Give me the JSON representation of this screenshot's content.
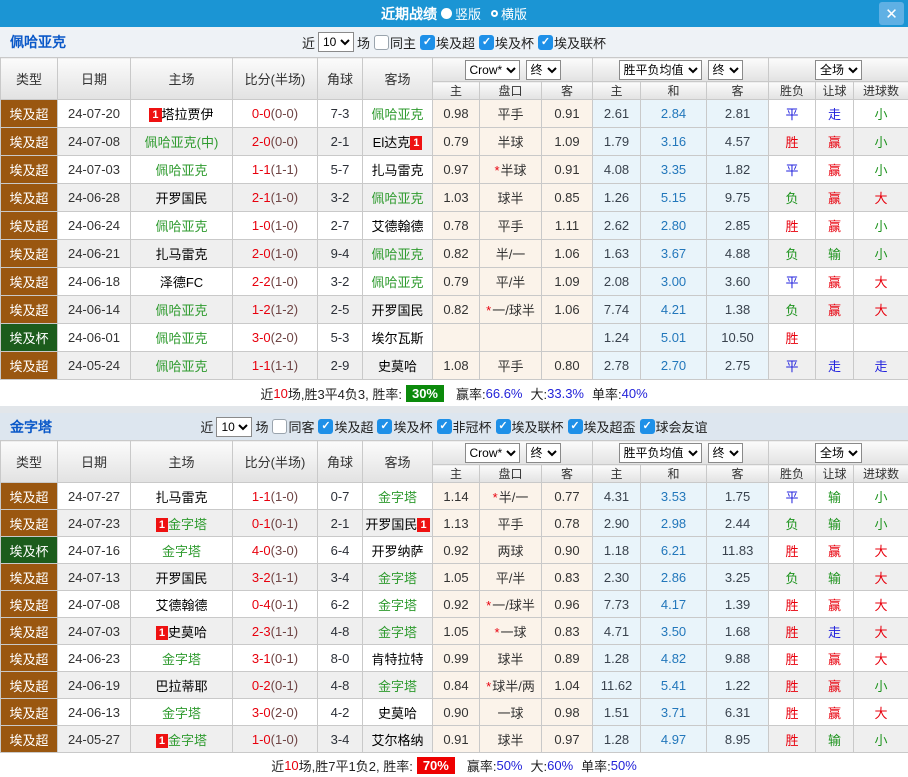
{
  "titlebar": {
    "title": "近期战绩",
    "vertical_label": "竖版",
    "horizontal_label": "横版",
    "close_glyph": "✕"
  },
  "colors": {
    "titlebar": "#1b95d4",
    "league_super": "#9a5710",
    "league_cup": "#1c5c1c",
    "team_highlight": "#2f9b2f",
    "win": "#e8000d",
    "draw": "#2222dd",
    "lose": "#1f941f",
    "rate_green": "#0b8a0b",
    "rate_red": "#ee0000"
  },
  "header": {
    "c1": "类型",
    "c2": "日期",
    "c3": "主场",
    "c4": "比分(半场)",
    "c5": "角球",
    "c6": "客场",
    "sel_crow": "Crow*",
    "sel_end1": "终",
    "sel_avg": "胜平负均值",
    "sel_end2": "终",
    "sel_scope": "全场",
    "s1": "主",
    "s2": "盘口",
    "s3": "客",
    "s4": "主",
    "s5": "和",
    "s6": "客",
    "s7": "胜负",
    "s8": "让球",
    "s9": "进球数"
  },
  "sections": [
    {
      "team": "佩哈亚克",
      "filter": {
        "near": "近",
        "games": "10",
        "chang": "场",
        "same": "同主",
        "same_checked": false,
        "leagues": [
          {
            "label": "埃及超",
            "checked": true
          },
          {
            "label": "埃及杯",
            "checked": true
          },
          {
            "label": "埃及联杯",
            "checked": true
          }
        ]
      },
      "rows": [
        {
          "type": "埃及超",
          "tc": "brown",
          "date": "24-07-20",
          "hb": "1",
          "hbp": "l",
          "home": "塔拉贾伊",
          "hT": false,
          "ft": "0-0",
          "half": "(0-0)",
          "corner": "7-3",
          "away": "佩哈亚克",
          "aT": true,
          "h1": "0.98",
          "star": false,
          "hcap": "平手",
          "h2": "0.91",
          "e1": "2.61",
          "e2": "2.84",
          "e3": "2.81",
          "r1": "平",
          "r1c": "blue",
          "r2": "走",
          "r2c": "blue",
          "r3": "小",
          "r3c": "green"
        },
        {
          "type": "埃及超",
          "tc": "brown",
          "date": "24-07-08",
          "home": "佩哈亚克(中)",
          "hT": true,
          "ft": "2-0",
          "half": "(0-0)",
          "corner": "2-1",
          "away": "El达克",
          "aT": false,
          "ab": "1",
          "abp": "r",
          "h1": "0.79",
          "star": false,
          "hcap": "半球",
          "h2": "1.09",
          "e1": "1.79",
          "e2": "3.16",
          "e3": "4.57",
          "r1": "胜",
          "r1c": "red",
          "r2": "赢",
          "r2c": "red",
          "r3": "小",
          "r3c": "green"
        },
        {
          "type": "埃及超",
          "tc": "brown",
          "date": "24-07-03",
          "home": "佩哈亚克",
          "hT": true,
          "ft": "1-1",
          "half": "(1-1)",
          "corner": "5-7",
          "away": "扎马雷克",
          "aT": false,
          "h1": "0.97",
          "star": true,
          "hcap": "半球",
          "h2": "0.91",
          "e1": "4.08",
          "e2": "3.35",
          "e3": "1.82",
          "r1": "平",
          "r1c": "blue",
          "r2": "赢",
          "r2c": "red",
          "r3": "小",
          "r3c": "green"
        },
        {
          "type": "埃及超",
          "tc": "brown",
          "date": "24-06-28",
          "home": "开罗国民",
          "hT": false,
          "ft": "2-1",
          "half": "(1-0)",
          "corner": "3-2",
          "away": "佩哈亚克",
          "aT": true,
          "h1": "1.03",
          "star": false,
          "hcap": "球半",
          "h2": "0.85",
          "e1": "1.26",
          "e2": "5.15",
          "e3": "9.75",
          "r1": "负",
          "r1c": "green",
          "r2": "赢",
          "r2c": "red",
          "r3": "大",
          "r3c": "red"
        },
        {
          "type": "埃及超",
          "tc": "brown",
          "date": "24-06-24",
          "home": "佩哈亚克",
          "hT": true,
          "ft": "1-0",
          "half": "(1-0)",
          "corner": "2-7",
          "away": "艾德翰德",
          "aT": false,
          "h1": "0.78",
          "star": false,
          "hcap": "平手",
          "h2": "1.11",
          "e1": "2.62",
          "e2": "2.80",
          "e3": "2.85",
          "r1": "胜",
          "r1c": "red",
          "r2": "赢",
          "r2c": "red",
          "r3": "小",
          "r3c": "green"
        },
        {
          "type": "埃及超",
          "tc": "brown",
          "date": "24-06-21",
          "home": "扎马雷克",
          "hT": false,
          "ft": "2-0",
          "half": "(1-0)",
          "corner": "9-4",
          "away": "佩哈亚克",
          "aT": true,
          "h1": "0.82",
          "star": false,
          "hcap": "半/一",
          "h2": "1.06",
          "e1": "1.63",
          "e2": "3.67",
          "e3": "4.88",
          "r1": "负",
          "r1c": "green",
          "r2": "输",
          "r2c": "green",
          "r3": "小",
          "r3c": "green"
        },
        {
          "type": "埃及超",
          "tc": "brown",
          "date": "24-06-18",
          "home": "泽德FC",
          "hT": false,
          "ft": "2-2",
          "half": "(1-0)",
          "corner": "3-2",
          "away": "佩哈亚克",
          "aT": true,
          "h1": "0.79",
          "star": false,
          "hcap": "平/半",
          "h2": "1.09",
          "e1": "2.08",
          "e2": "3.00",
          "e3": "3.60",
          "r1": "平",
          "r1c": "blue",
          "r2": "赢",
          "r2c": "red",
          "r3": "大",
          "r3c": "red"
        },
        {
          "type": "埃及超",
          "tc": "brown",
          "date": "24-06-14",
          "home": "佩哈亚克",
          "hT": true,
          "ft": "1-2",
          "half": "(1-2)",
          "corner": "2-5",
          "away": "开罗国民",
          "aT": false,
          "h1": "0.82",
          "star": true,
          "hcap": "一/球半",
          "h2": "1.06",
          "e1": "7.74",
          "e2": "4.21",
          "e3": "1.38",
          "r1": "负",
          "r1c": "green",
          "r2": "赢",
          "r2c": "red",
          "r3": "大",
          "r3c": "red"
        },
        {
          "type": "埃及杯",
          "tc": "green",
          "date": "24-06-01",
          "home": "佩哈亚克",
          "hT": true,
          "ft": "3-0",
          "half": "(2-0)",
          "corner": "5-3",
          "away": "埃尔瓦斯",
          "aT": false,
          "h1": "",
          "star": false,
          "hcap": "",
          "h2": "",
          "e1": "1.24",
          "e2": "5.01",
          "e3": "10.50",
          "r1": "胜",
          "r1c": "red",
          "r2": "",
          "r3": ""
        },
        {
          "type": "埃及超",
          "tc": "brown",
          "date": "24-05-24",
          "home": "佩哈亚克",
          "hT": true,
          "ft": "1-1",
          "half": "(1-1)",
          "corner": "2-9",
          "away": "史莫哈",
          "aT": false,
          "h1": "1.08",
          "star": false,
          "hcap": "平手",
          "h2": "0.80",
          "e1": "2.78",
          "e2": "2.70",
          "e3": "2.75",
          "r1": "平",
          "r1c": "blue",
          "r2": "走",
          "r2c": "blue",
          "r3": "走",
          "r3c": "blue"
        }
      ],
      "summary": {
        "near": "近",
        "n": "10",
        "mid": "场,胜3平4负3, 胜率:",
        "rate": "30%",
        "rate_bg": "green",
        "l1": "赢率:",
        "v1": "66.6%",
        "l2": "大:",
        "v2": "33.3%",
        "l3": "单率:",
        "v3": "40%"
      }
    },
    {
      "team": "金字塔",
      "filter": {
        "near": "近",
        "games": "10",
        "chang": "场",
        "same": "同客",
        "same_checked": false,
        "leagues": [
          {
            "label": "埃及超",
            "checked": true
          },
          {
            "label": "埃及杯",
            "checked": true
          },
          {
            "label": "非冠杯",
            "checked": true
          },
          {
            "label": "埃及联杯",
            "checked": true
          },
          {
            "label": "埃及超盃",
            "checked": true
          },
          {
            "label": "球会友谊",
            "checked": true
          }
        ]
      },
      "rows": [
        {
          "type": "埃及超",
          "tc": "brown",
          "date": "24-07-27",
          "home": "扎马雷克",
          "hT": false,
          "ft": "1-1",
          "half": "(1-0)",
          "corner": "0-7",
          "away": "金字塔",
          "aT": true,
          "h1": "1.14",
          "star": true,
          "hcap": "半/一",
          "h2": "0.77",
          "e1": "4.31",
          "e2": "3.53",
          "e3": "1.75",
          "r1": "平",
          "r1c": "blue",
          "r2": "输",
          "r2c": "green",
          "r3": "小",
          "r3c": "green"
        },
        {
          "type": "埃及超",
          "tc": "brown",
          "date": "24-07-23",
          "hb": "1",
          "hbp": "l",
          "home": "金字塔",
          "hT": true,
          "ft": "0-1",
          "half": "(0-1)",
          "corner": "2-1",
          "away": "开罗国民",
          "aT": false,
          "ab": "1",
          "abp": "r",
          "h1": "1.13",
          "star": false,
          "hcap": "平手",
          "h2": "0.78",
          "e1": "2.90",
          "e2": "2.98",
          "e3": "2.44",
          "r1": "负",
          "r1c": "green",
          "r2": "输",
          "r2c": "green",
          "r3": "小",
          "r3c": "green"
        },
        {
          "type": "埃及杯",
          "tc": "green",
          "date": "24-07-16",
          "home": "金字塔",
          "hT": true,
          "ft": "4-0",
          "half": "(3-0)",
          "corner": "6-4",
          "away": "开罗纳萨",
          "aT": false,
          "h1": "0.92",
          "star": false,
          "hcap": "两球",
          "h2": "0.90",
          "e1": "1.18",
          "e2": "6.21",
          "e3": "11.83",
          "r1": "胜",
          "r1c": "red",
          "r2": "赢",
          "r2c": "red",
          "r3": "大",
          "r3c": "red"
        },
        {
          "type": "埃及超",
          "tc": "brown",
          "date": "24-07-13",
          "home": "开罗国民",
          "hT": false,
          "ft": "3-2",
          "half": "(1-1)",
          "corner": "3-4",
          "away": "金字塔",
          "aT": true,
          "h1": "1.05",
          "star": false,
          "hcap": "平/半",
          "h2": "0.83",
          "e1": "2.30",
          "e2": "2.86",
          "e3": "3.25",
          "r1": "负",
          "r1c": "green",
          "r2": "输",
          "r2c": "green",
          "r3": "大",
          "r3c": "red"
        },
        {
          "type": "埃及超",
          "tc": "brown",
          "date": "24-07-08",
          "home": "艾德翰德",
          "hT": false,
          "ft": "0-4",
          "half": "(0-1)",
          "corner": "6-2",
          "away": "金字塔",
          "aT": true,
          "h1": "0.92",
          "star": true,
          "hcap": "一/球半",
          "h2": "0.96",
          "e1": "7.73",
          "e2": "4.17",
          "e3": "1.39",
          "r1": "胜",
          "r1c": "red",
          "r2": "赢",
          "r2c": "red",
          "r3": "大",
          "r3c": "red"
        },
        {
          "type": "埃及超",
          "tc": "brown",
          "date": "24-07-03",
          "hb": "1",
          "hbp": "l",
          "home": "史莫哈",
          "hT": false,
          "ft": "2-3",
          "half": "(1-1)",
          "corner": "4-8",
          "away": "金字塔",
          "aT": true,
          "h1": "1.05",
          "star": true,
          "hcap": "一球",
          "h2": "0.83",
          "e1": "4.71",
          "e2": "3.50",
          "e3": "1.68",
          "r1": "胜",
          "r1c": "red",
          "r2": "走",
          "r2c": "blue",
          "r3": "大",
          "r3c": "red"
        },
        {
          "type": "埃及超",
          "tc": "brown",
          "date": "24-06-23",
          "home": "金字塔",
          "hT": true,
          "ft": "3-1",
          "half": "(0-1)",
          "corner": "8-0",
          "away": "肯特拉特",
          "aT": false,
          "h1": "0.99",
          "star": false,
          "hcap": "球半",
          "h2": "0.89",
          "e1": "1.28",
          "e2": "4.82",
          "e3": "9.88",
          "r1": "胜",
          "r1c": "red",
          "r2": "赢",
          "r2c": "red",
          "r3": "大",
          "r3c": "red"
        },
        {
          "type": "埃及超",
          "tc": "brown",
          "date": "24-06-19",
          "home": "巴拉蒂耶",
          "hT": false,
          "ft": "0-2",
          "half": "(0-1)",
          "corner": "4-8",
          "away": "金字塔",
          "aT": true,
          "h1": "0.84",
          "star": true,
          "hcap": "球半/两",
          "h2": "1.04",
          "e1": "11.62",
          "e2": "5.41",
          "e3": "1.22",
          "r1": "胜",
          "r1c": "red",
          "r2": "赢",
          "r2c": "red",
          "r3": "小",
          "r3c": "green"
        },
        {
          "type": "埃及超",
          "tc": "brown",
          "date": "24-06-13",
          "home": "金字塔",
          "hT": true,
          "ft": "3-0",
          "half": "(2-0)",
          "corner": "4-2",
          "away": "史莫哈",
          "aT": false,
          "h1": "0.90",
          "star": false,
          "hcap": "一球",
          "h2": "0.98",
          "e1": "1.51",
          "e2": "3.71",
          "e3": "6.31",
          "r1": "胜",
          "r1c": "red",
          "r2": "赢",
          "r2c": "red",
          "r3": "大",
          "r3c": "red"
        },
        {
          "type": "埃及超",
          "tc": "brown",
          "date": "24-05-27",
          "hb": "1",
          "hbp": "l",
          "home": "金字塔",
          "hT": true,
          "ft": "1-0",
          "half": "(1-0)",
          "corner": "3-4",
          "away": "艾尔格纳",
          "aT": false,
          "h1": "0.91",
          "star": false,
          "hcap": "球半",
          "h2": "0.97",
          "e1": "1.28",
          "e2": "4.97",
          "e3": "8.95",
          "r1": "胜",
          "r1c": "red",
          "r2": "输",
          "r2c": "green",
          "r3": "小",
          "r3c": "green"
        }
      ],
      "summary": {
        "near": "近",
        "n": "10",
        "mid": "场,胜7平1负2, 胜率:",
        "rate": "70%",
        "rate_bg": "red",
        "l1": "赢率:",
        "v1": "50%",
        "l2": "大:",
        "v2": "60%",
        "l3": "单率:",
        "v3": "50%"
      }
    }
  ]
}
